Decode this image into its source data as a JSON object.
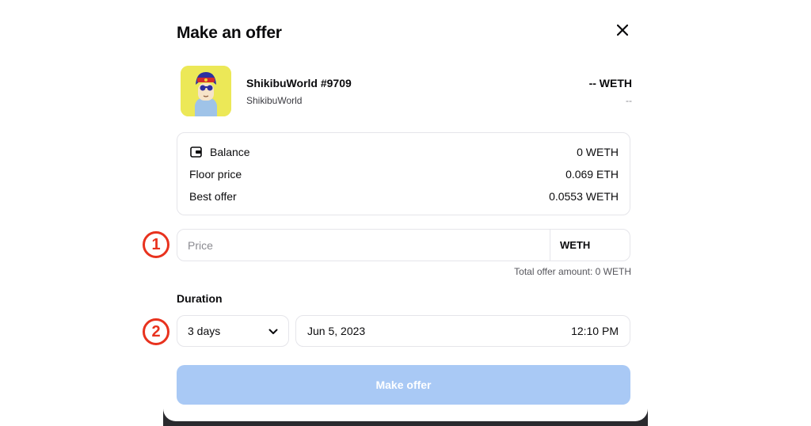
{
  "modal": {
    "title": "Make an offer",
    "close_icon": "close-icon"
  },
  "item": {
    "name": "ShikibuWorld #9709",
    "collection": "ShikibuWorld",
    "price": "-- WETH",
    "usd": "--"
  },
  "info": {
    "balance_label": "Balance",
    "balance_value": "0 WETH",
    "floor_label": "Floor price",
    "floor_value": "0.069 ETH",
    "best_label": "Best offer",
    "best_value": "0.0553 WETH",
    "balance_icon": "wallet-icon"
  },
  "price_field": {
    "placeholder": "Price",
    "currency": "WETH",
    "total": "Total offer amount: 0 WETH"
  },
  "duration": {
    "label": "Duration",
    "selected": "3 days",
    "date": "Jun 5, 2023",
    "time": "12:10 PM"
  },
  "submit_label": "Make offer",
  "annotations": {
    "step1": "1",
    "step2": "2"
  },
  "colors": {
    "accent_disabled": "#a9c9f5",
    "annotation": "#e8321e"
  }
}
